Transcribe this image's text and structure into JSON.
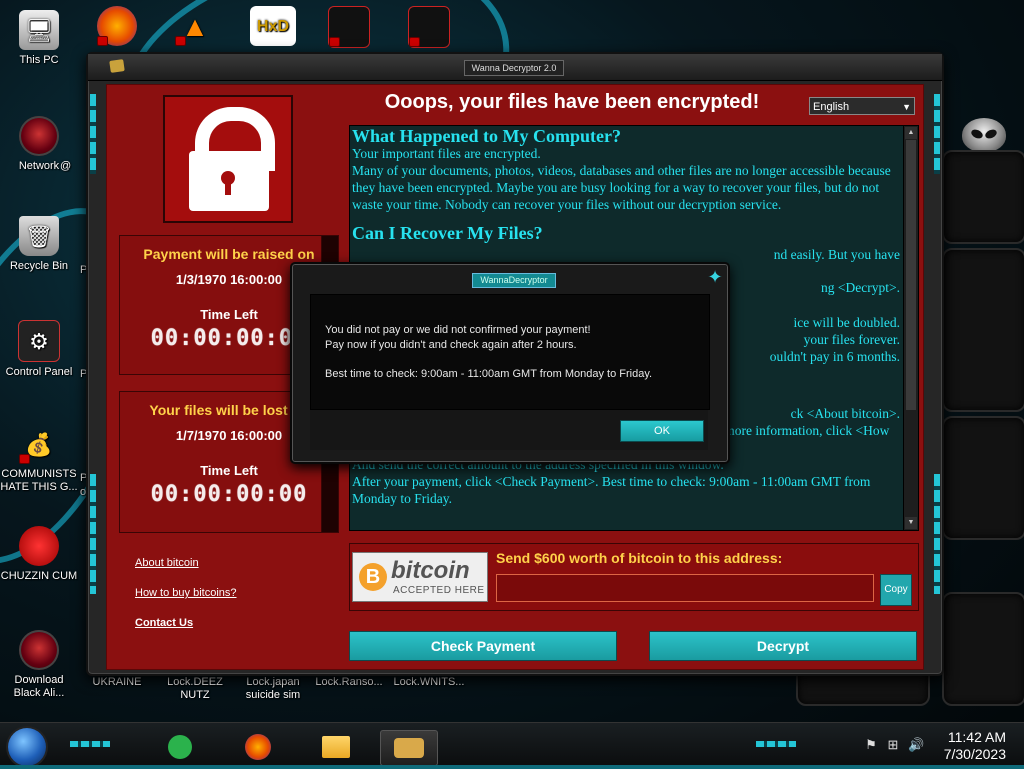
{
  "desktop": {
    "icons": [
      {
        "label": "This PC",
        "icon": "computer-icon"
      },
      {
        "label": "Network",
        "icon": "alien-network-icon"
      },
      {
        "label": "Recycle Bin",
        "icon": "recycle-bin-icon"
      },
      {
        "label": "Control Panel",
        "icon": "control-panel-icon"
      },
      {
        "label": "COMMUNISTS HATE THIS G...",
        "icon": "money-bag-icon"
      },
      {
        "label": "CHUZZIN CUM",
        "icon": "red-creature-icon"
      },
      {
        "label": "Download Black Ali...",
        "icon": "alien-download-icon"
      },
      {
        "label": "UKRAINE",
        "icon": "ukraine-icon"
      },
      {
        "label": "Lock.DEEZ NUTZ",
        "icon": "locked-file-icon"
      },
      {
        "label": "Lock.japan suicide sim",
        "icon": "locked-file-icon"
      },
      {
        "label": "Lock.Ranso...",
        "icon": "locked-file-icon"
      },
      {
        "label": "Lock.WNITS...",
        "icon": "locked-file-icon"
      }
    ],
    "top_row_icons": [
      "firefox-icon",
      "vlc-icon",
      "hxd-icon",
      "alien-shortcut-icon",
      "alien-shortcut-icon"
    ],
    "partial_labels": {
      "p1": "@",
      "p2": "Pi",
      "p3": "Pi",
      "p4": "P",
      "p5": "o"
    }
  },
  "main_window": {
    "title": "Wanna Decryptor 2.0",
    "headline": "Ooops, your files have been encrypted!",
    "language": "English",
    "payment_raised": {
      "label": "Payment will be raised on",
      "date": "1/3/1970 16:00:00",
      "time_left_label": "Time Left",
      "countdown": "00:00:00:00"
    },
    "files_lost": {
      "label": "Your files will be lost on",
      "date": "1/7/1970 16:00:00",
      "time_left_label": "Time Left",
      "countdown": "00:00:00:00"
    },
    "text": {
      "heading1": "What Happened to My Computer?",
      "p1a": "Your important files are encrypted.",
      "p1b": "Many of your documents, photos, videos, databases and other files are no longer accessible because they have been encrypted. Maybe you are busy looking for a way to recover your files, but do not waste your time. Nobody can recover your files without our decryption service.",
      "heading2": "Can I Recover My Files?",
      "frag1": "nd easily. But you have",
      "frag2": "ng <Decrypt>.",
      "frag3": "ice will be doubled.",
      "frag4": "your files forever.",
      "frag5": "ouldn't pay in 6 months.",
      "frag6": "ck <About bitcoin>.",
      "p3a": "Please check the current price of Bitcoin and buy some bitcoins. For more information, click <How to buy bitcoins>.",
      "p3b": "And send the correct amount to the address specified in this window.",
      "p3c": "After your payment, click <Check Payment>. Best time to check: 9:00am - 11:00am GMT from Monday to Friday."
    },
    "links": {
      "about_bitcoin": "About bitcoin",
      "how_to_buy": "How to buy bitcoins?",
      "contact_us": "Contact Us"
    },
    "bitcoin": {
      "coin_letter": "B",
      "word": "bitcoin",
      "accepted": "ACCEPTED HERE",
      "send_label": "Send $600 worth of bitcoin to this address:",
      "address": "",
      "copy_label": "Copy"
    },
    "buttons": {
      "check_payment": "Check Payment",
      "decrypt": "Decrypt"
    }
  },
  "dialog": {
    "title": "WannaDecryptor",
    "line1": "You did not pay or we did not confirmed your payment!",
    "line2": "Pay now if you didn't and check again after 2 hours.",
    "line3": "Best time to check: 9:00am - 11:00am GMT from Monday to Friday.",
    "ok_label": "OK"
  },
  "taskbar": {
    "time": "11:42 AM",
    "date": "7/30/2023",
    "apps": [
      "start-orb-icon",
      "feedly-icon",
      "firefox-icon",
      "file-explorer-icon",
      "wannacry-handshake-icon"
    ]
  },
  "colors": {
    "window_red": "#8b1010",
    "accent_cyan": "#27e2ef",
    "warning_yellow": "#ffd24a",
    "button_teal": "#22a7ad"
  }
}
